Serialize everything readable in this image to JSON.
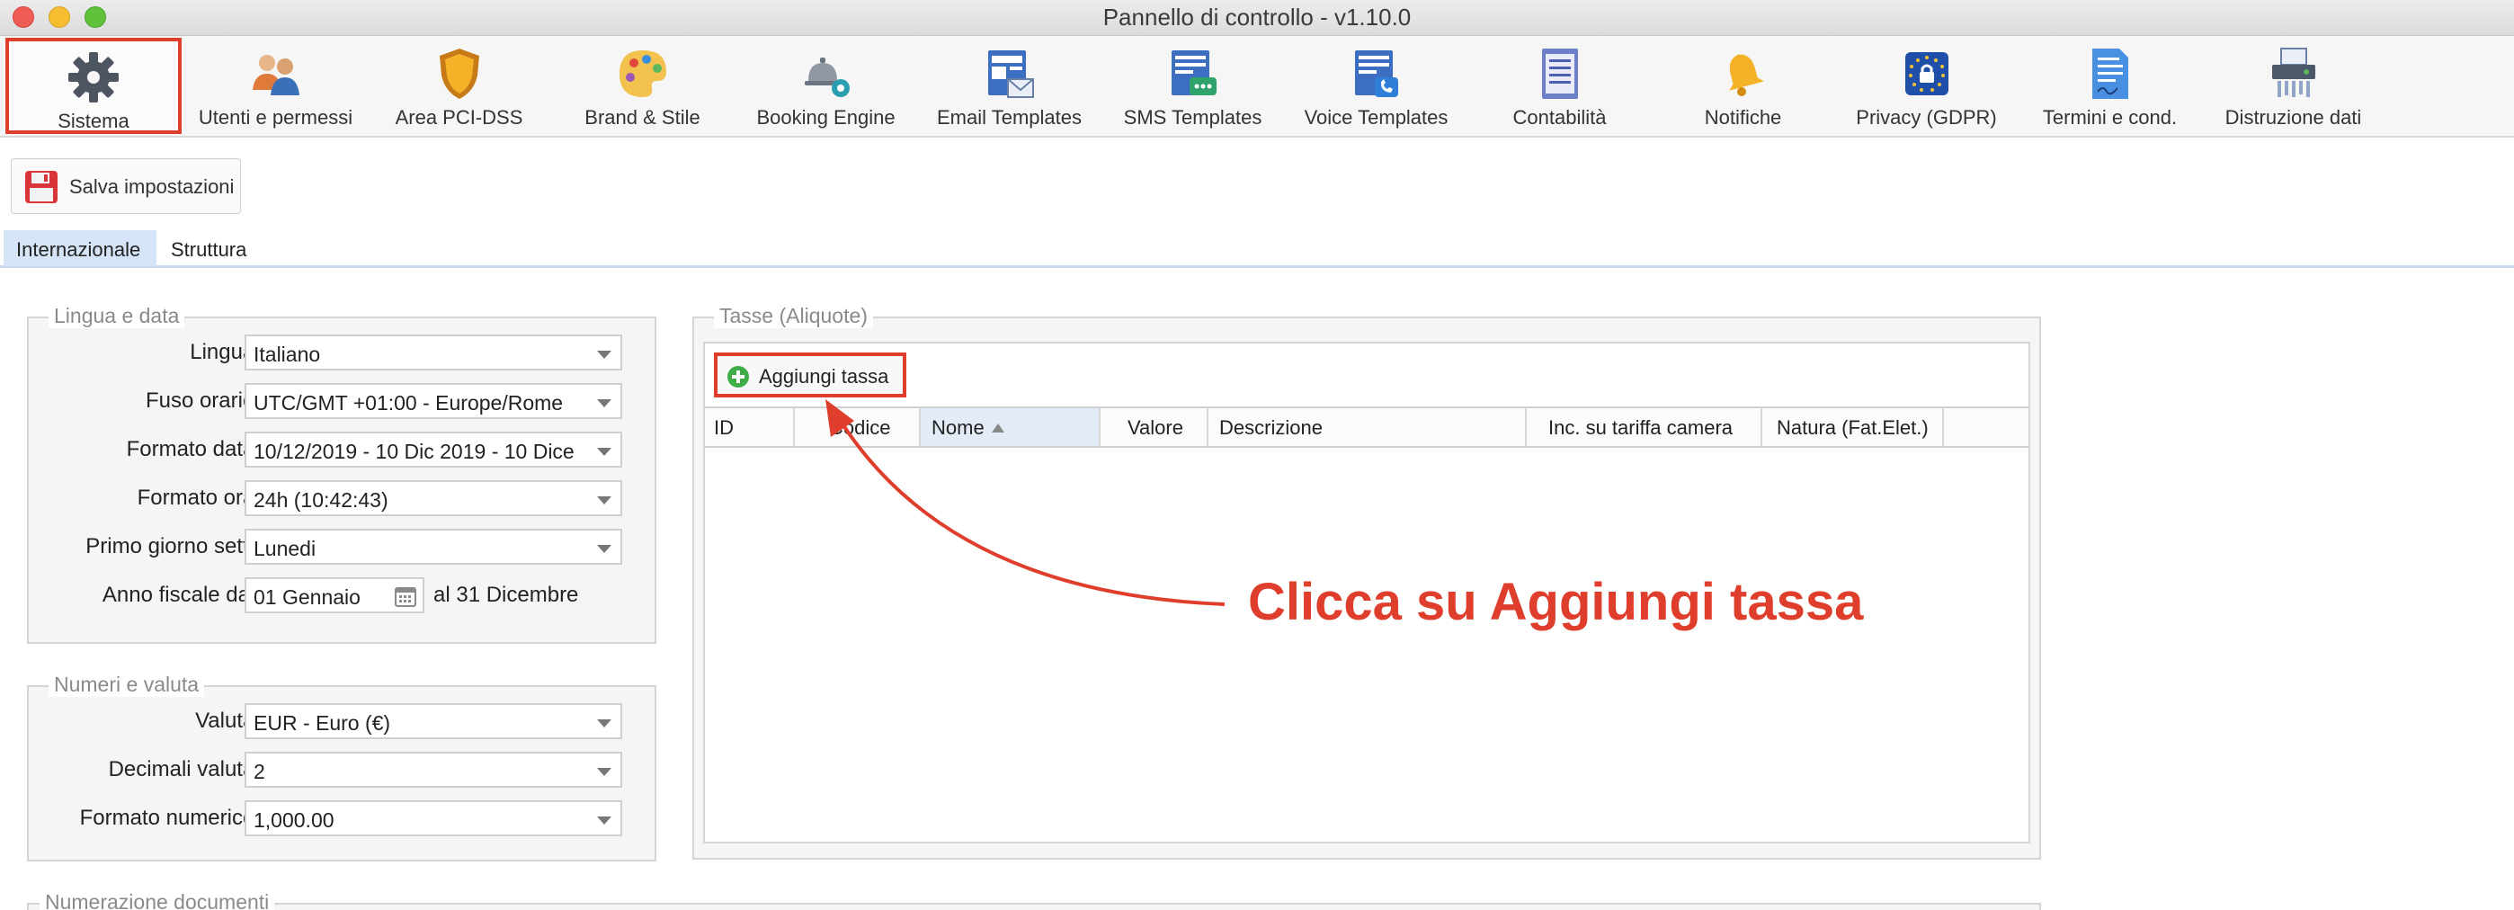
{
  "window": {
    "title": "Pannello di controllo - v1.10.0"
  },
  "toolbar": {
    "items": [
      {
        "label": "Sistema",
        "icon": "gear-icon"
      },
      {
        "label": "Utenti e permessi",
        "icon": "users-icon"
      },
      {
        "label": "Area PCI-DSS",
        "icon": "shield-icon"
      },
      {
        "label": "Brand & Stile",
        "icon": "palette-icon"
      },
      {
        "label": "Booking Engine",
        "icon": "service-bell-icon"
      },
      {
        "label": "Email Templates",
        "icon": "email-template-icon"
      },
      {
        "label": "SMS Templates",
        "icon": "sms-template-icon"
      },
      {
        "label": "Voice Templates",
        "icon": "voice-template-icon"
      },
      {
        "label": "Contabilità",
        "icon": "ledger-icon"
      },
      {
        "label": "Notifiche",
        "icon": "bell-icon"
      },
      {
        "label": "Privacy (GDPR)",
        "icon": "gdpr-lock-icon"
      },
      {
        "label": "Termini e cond.",
        "icon": "document-icon"
      },
      {
        "label": "Distruzione dati",
        "icon": "shredder-icon"
      }
    ],
    "active_index": 0
  },
  "actions": {
    "save_label": "Salva impostazioni"
  },
  "tabs": [
    {
      "label": "Internazionale",
      "active": true
    },
    {
      "label": "Struttura",
      "active": false
    }
  ],
  "lingua_data": {
    "legend": "Lingua e data",
    "lingua_label": "Lingua:",
    "lingua_value": "Italiano",
    "fuso_label": "Fuso orario:",
    "fuso_value": "UTC/GMT +01:00 - Europe/Rome",
    "formato_data_label": "Formato data:",
    "formato_data_value": "10/12/2019 - 10 Dic 2019 - 10 Dice",
    "formato_ora_label": "Formato ora:",
    "formato_ora_value": "24h (10:42:43)",
    "primo_giorno_label": "Primo giorno sett.:",
    "primo_giorno_value": "Lunedi",
    "anno_fiscale_label": "Anno fiscale dal:",
    "anno_fiscale_value": "01 Gennaio",
    "anno_fiscale_end": "al 31 Dicembre"
  },
  "numeri_valuta": {
    "legend": "Numeri e valuta",
    "valuta_label": "Valuta:",
    "valuta_value": "EUR - Euro (€)",
    "decimali_label": "Decimali valuta:",
    "decimali_value": "2",
    "formato_num_label": "Formato numerico:",
    "formato_num_value": "1,000.00"
  },
  "numerazione": {
    "legend": "Numerazione documenti"
  },
  "tasse": {
    "legend": "Tasse (Aliquote)",
    "add_label": "Aggiungi tassa",
    "columns": [
      "ID",
      "Codice",
      "Nome",
      "Valore",
      "Descrizione",
      "Inc. su tariffa camera",
      "Natura (Fat.Elet.)"
    ],
    "sorted_column": "Nome"
  },
  "annotation": {
    "text": "Clicca su Aggiungi tassa",
    "color": "#e03e2d"
  }
}
